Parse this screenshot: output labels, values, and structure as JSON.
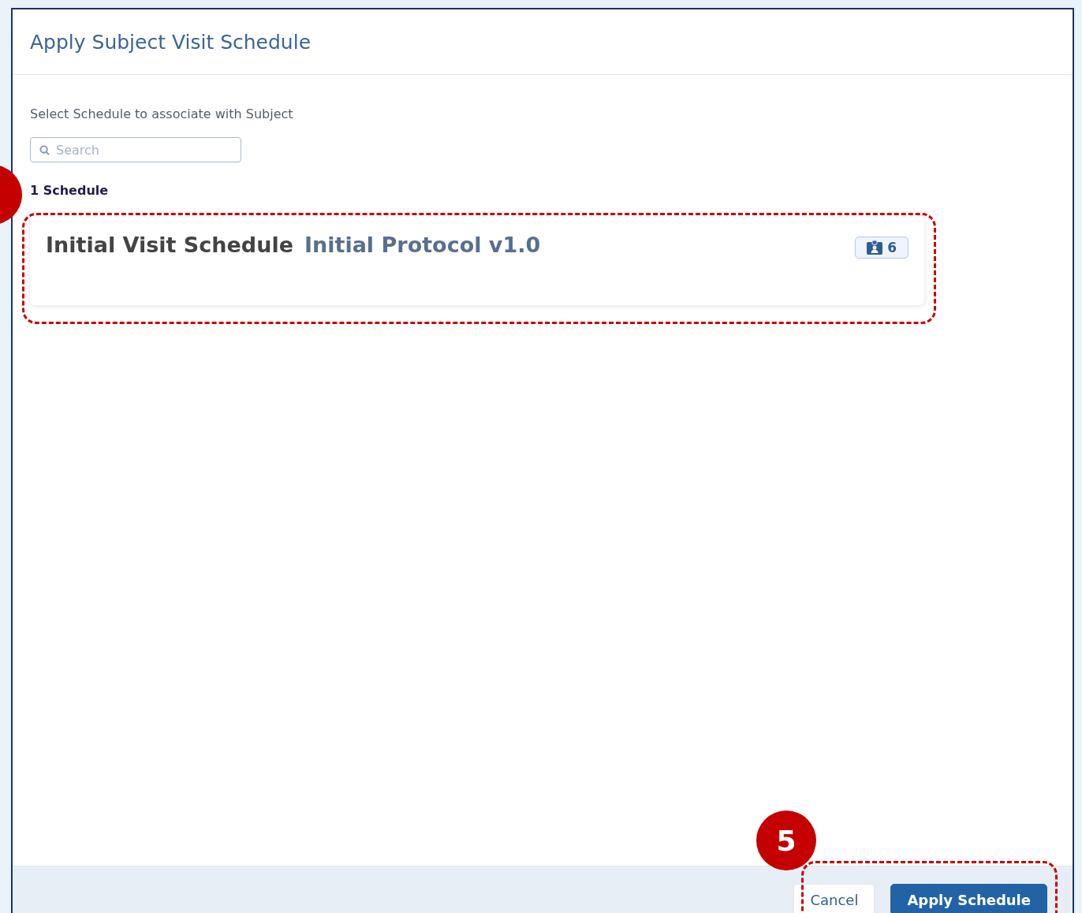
{
  "dialog": {
    "title": "Apply Subject Visit Schedule",
    "instruction": "Select Schedule to associate with Subject",
    "search": {
      "placeholder": "Search"
    },
    "count_label": "1 Schedule",
    "schedules": [
      {
        "name": "Initial Visit Schedule",
        "protocol": "Initial Protocol v1.0",
        "visits": "6"
      }
    ],
    "buttons": [
      {
        "label": "Cancel",
        "kind": "secondary"
      },
      {
        "label": "Apply Schedule",
        "kind": "primary"
      }
    ]
  },
  "annotations": [
    {
      "label": "5"
    }
  ]
}
